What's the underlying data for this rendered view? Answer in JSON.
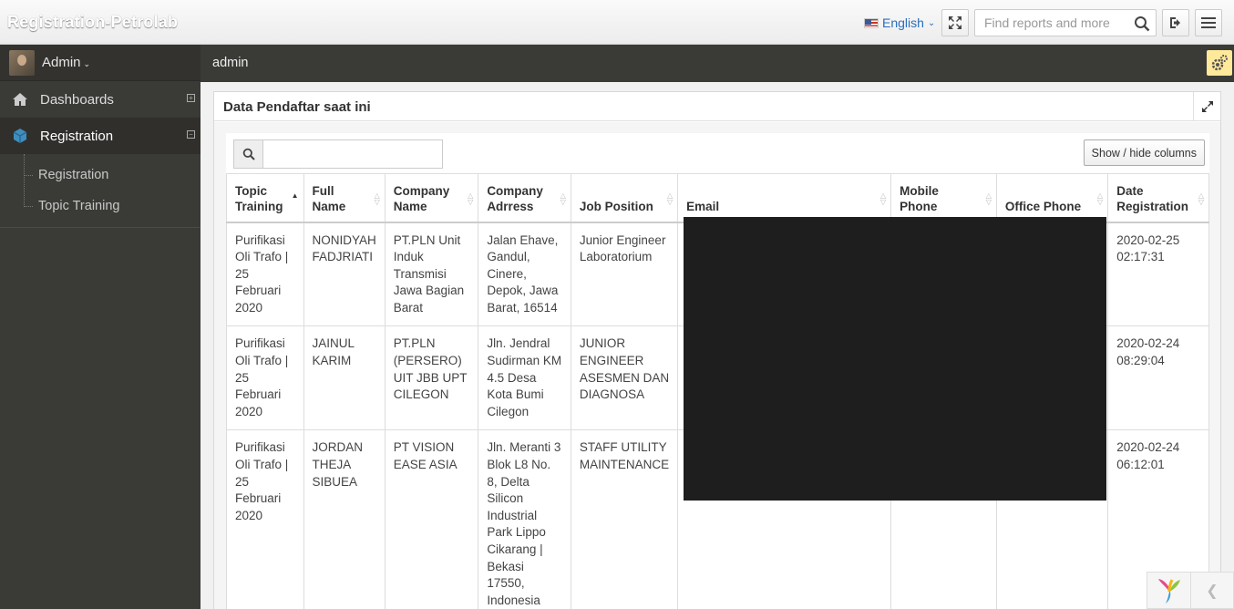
{
  "app": {
    "title": "Registration-Petrolab"
  },
  "topbar": {
    "language": "English",
    "search_placeholder": "Find reports and more"
  },
  "sidebar": {
    "user": "Admin",
    "items": [
      {
        "label": "Dashboards",
        "icon": "home-icon"
      },
      {
        "label": "Registration",
        "icon": "cube-icon"
      }
    ],
    "subitems": [
      {
        "label": "Registration"
      },
      {
        "label": "Topic Training"
      }
    ]
  },
  "breadcrumb": "admin",
  "panel": {
    "title": "Data Pendaftar saat ini",
    "show_hide_label": "Show / hide columns"
  },
  "table": {
    "columns": [
      "Topic Training",
      "Full Name",
      "Company Name",
      "Company Adrress",
      "Job Position",
      "Email",
      "Mobile Phone",
      "Office Phone",
      "Date Registration"
    ],
    "rows": [
      {
        "topic": "Purifikasi Oli Trafo | 25 Februari 2020",
        "name": "NONIDYAH FADJRIATI",
        "company": "PT.PLN Unit Induk Transmisi Jawa Bagian Barat",
        "address": "Jalan Ehave, Gandul, Cinere, Depok, Jawa Barat, 16514",
        "job": "Junior Engineer Laboratorium",
        "email": "",
        "mobile": "",
        "office": "",
        "date": "2020-02-25 02:17:31"
      },
      {
        "topic": "Purifikasi Oli Trafo | 25 Februari 2020",
        "name": "JAINUL KARIM",
        "company": "PT.PLN (PERSERO) UIT JBB UPT CILEGON",
        "address": "Jln. Jendral Sudirman KM 4.5 Desa Kota Bumi Cilegon",
        "job": "JUNIOR ENGINEER ASESMEN DAN DIAGNOSA",
        "email": "",
        "mobile": "",
        "office": "",
        "date": "2020-02-24 08:29:04"
      },
      {
        "topic": "Purifikasi Oli Trafo | 25 Februari 2020",
        "name": "JORDAN THEJA SIBUEA",
        "company": "PT VISION EASE ASIA",
        "address": "Jln. Meranti 3 Blok L8 No. 8, Delta Silicon Industrial Park Lippo Cikarang | Bekasi 17550, Indonesia",
        "job": "STAFF UTILITY MAINTENANCE",
        "email": "",
        "mobile": "",
        "office": "",
        "date": "2020-02-24 06:12:01"
      }
    ]
  }
}
